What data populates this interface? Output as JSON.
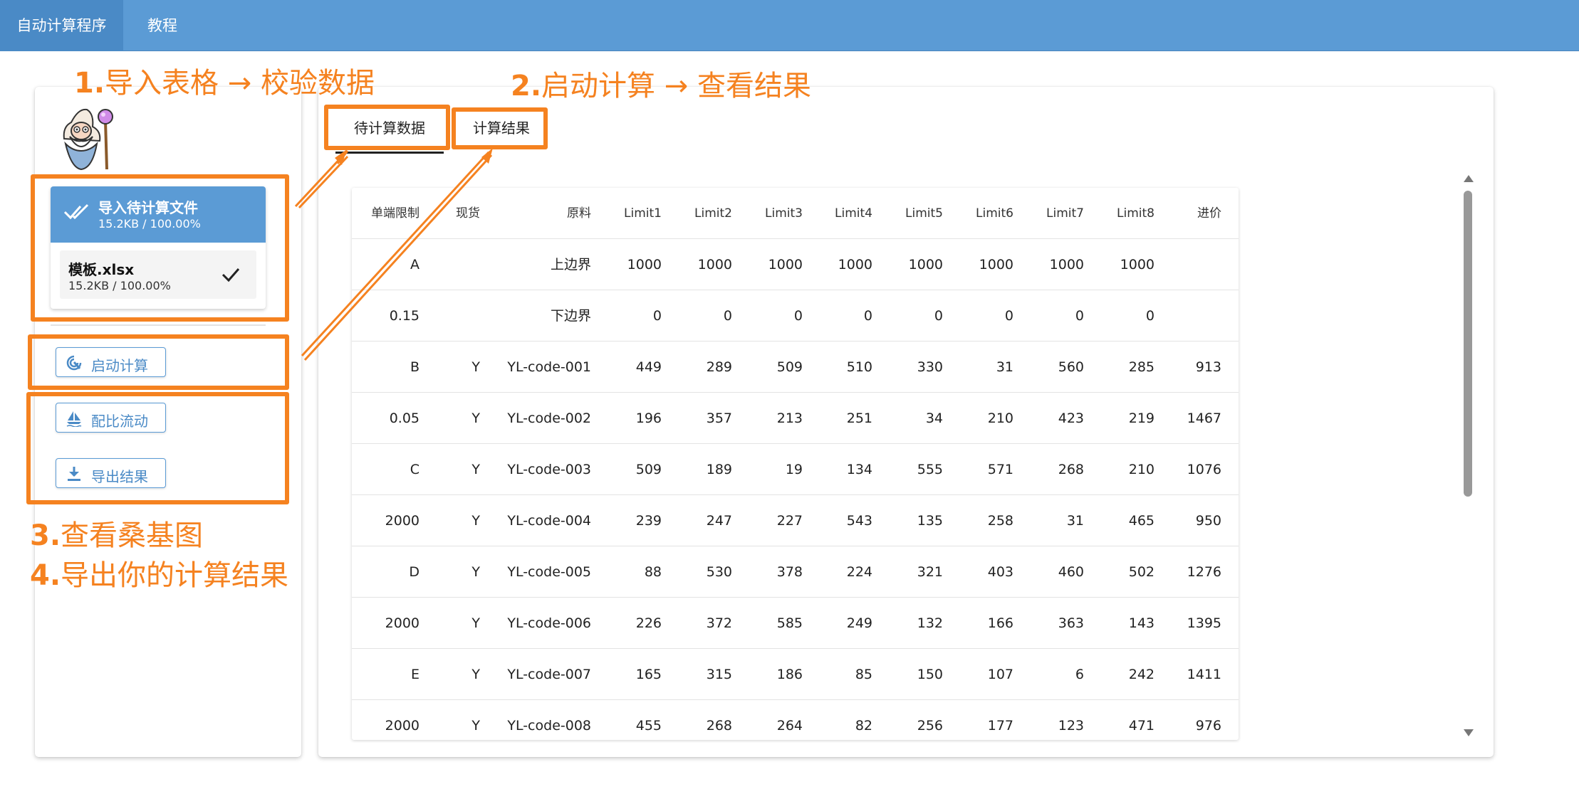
{
  "nav": {
    "tabs": [
      {
        "label": "自动计算程序"
      },
      {
        "label": "教程"
      }
    ]
  },
  "annotations": {
    "step1_num": "1.",
    "step1_text": "导入表格 → 校验数据",
    "step2_num": "2.",
    "step2_text": "启动计算 → 查看结果",
    "step3_num": "3.",
    "step3_text": "查看桑基图",
    "step4_num": "4.",
    "step4_text": "导出你的计算结果"
  },
  "sidebar": {
    "upload": {
      "title": "导入待计算文件",
      "subtitle": "15.2KB / 100.00%"
    },
    "file": {
      "name": "模板.xlsx",
      "size": "15.2KB / 100.00%"
    },
    "buttons": {
      "start": "启动计算",
      "sankey": "配比流动",
      "export": "导出结果"
    }
  },
  "tabs": {
    "pending": "待计算数据",
    "result": "计算结果"
  },
  "table": {
    "headers": [
      "单端限制",
      "现货",
      "原料",
      "Limit1",
      "Limit2",
      "Limit3",
      "Limit4",
      "Limit5",
      "Limit6",
      "Limit7",
      "Limit8",
      "进价"
    ],
    "rows": [
      [
        "A",
        "",
        "上边界",
        "1000",
        "1000",
        "1000",
        "1000",
        "1000",
        "1000",
        "1000",
        "1000",
        ""
      ],
      [
        "0.15",
        "",
        "下边界",
        "0",
        "0",
        "0",
        "0",
        "0",
        "0",
        "0",
        "0",
        ""
      ],
      [
        "B",
        "Y",
        "YL-code-001",
        "449",
        "289",
        "509",
        "510",
        "330",
        "31",
        "560",
        "285",
        "913"
      ],
      [
        "0.05",
        "Y",
        "YL-code-002",
        "196",
        "357",
        "213",
        "251",
        "34",
        "210",
        "423",
        "219",
        "1467"
      ],
      [
        "C",
        "Y",
        "YL-code-003",
        "509",
        "189",
        "19",
        "134",
        "555",
        "571",
        "268",
        "210",
        "1076"
      ],
      [
        "2000",
        "Y",
        "YL-code-004",
        "239",
        "247",
        "227",
        "543",
        "135",
        "258",
        "31",
        "465",
        "950"
      ],
      [
        "D",
        "Y",
        "YL-code-005",
        "88",
        "530",
        "378",
        "224",
        "321",
        "403",
        "460",
        "502",
        "1276"
      ],
      [
        "2000",
        "Y",
        "YL-code-006",
        "226",
        "372",
        "585",
        "249",
        "132",
        "166",
        "363",
        "143",
        "1395"
      ],
      [
        "E",
        "Y",
        "YL-code-007",
        "165",
        "315",
        "186",
        "85",
        "150",
        "107",
        "6",
        "242",
        "1411"
      ],
      [
        "2000",
        "Y",
        "YL-code-008",
        "455",
        "268",
        "264",
        "82",
        "256",
        "177",
        "123",
        "471",
        "976"
      ]
    ]
  },
  "colors": {
    "primary": "#5b9bd5",
    "annotation": "#f58220"
  }
}
